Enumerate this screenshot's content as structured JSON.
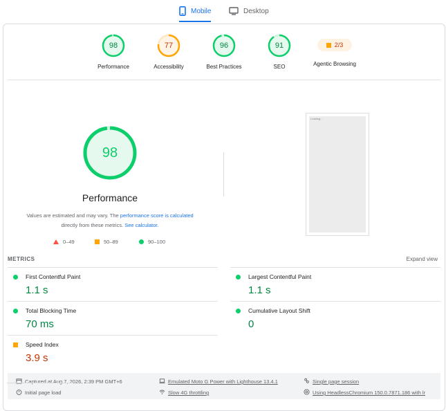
{
  "tabs": [
    {
      "label": "Mobile",
      "active": true,
      "icon": "mobile-phone-icon"
    },
    {
      "label": "Desktop",
      "active": false,
      "icon": "monitor-icon"
    }
  ],
  "categories": [
    {
      "score": "98",
      "label": "Performance",
      "status": "good",
      "fraction": 0.98
    },
    {
      "score": "77",
      "label": "Accessibility",
      "status": "average",
      "fraction": 0.77
    },
    {
      "score": "96",
      "label": "Best Practices",
      "status": "good",
      "fraction": 0.96
    },
    {
      "score": "91",
      "label": "SEO",
      "status": "good",
      "fraction": 0.91
    },
    {
      "score": "2/3",
      "label": "Agentic Browsing",
      "status": "average"
    }
  ],
  "performance": {
    "score": "98",
    "fraction": 0.98,
    "title": "Performance",
    "note_prefix": "Values are estimated and may vary. The ",
    "note_link1": "performance score is calculated",
    "note_middle": " directly from these metrics. ",
    "note_link2": "See calculator.",
    "legend": [
      {
        "range": "0–49",
        "shape": "triangle",
        "color": "#ff4e42"
      },
      {
        "range": "50–89",
        "shape": "square",
        "color": "#ffa400"
      },
      {
        "range": "90–100",
        "shape": "circle",
        "color": "#0cce6b"
      }
    ],
    "thumbnail_text": "Loading..."
  },
  "metrics": {
    "title": "METRICS",
    "expand_label": "Expand view",
    "items": [
      {
        "name": "First Contentful Paint",
        "value": "1.1 s",
        "status": "good"
      },
      {
        "name": "Largest Contentful Paint",
        "value": "1.1 s",
        "status": "good"
      },
      {
        "name": "Total Blocking Time",
        "value": "70 ms",
        "status": "good"
      },
      {
        "name": "Cumulative Layout Shift",
        "value": "0",
        "status": "good"
      },
      {
        "name": "Speed Index",
        "value": "3.9 s",
        "status": "average"
      }
    ]
  },
  "footer": {
    "captured": "Captured at Aug 7, 2026, 2:39 PM GMT+6",
    "load": "Initial page load",
    "device": "Emulated Moto G Power with Lighthouse 13.4.1",
    "throttling": "Slow 4G throttling",
    "session": "Single page session",
    "browser": "Using HeadlessChromium 150.0.7871.186 with lr"
  },
  "colors": {
    "good": "#0cce6b",
    "average": "#ffa400",
    "poor": "#ff4e42",
    "accent": "#1a73e8"
  }
}
